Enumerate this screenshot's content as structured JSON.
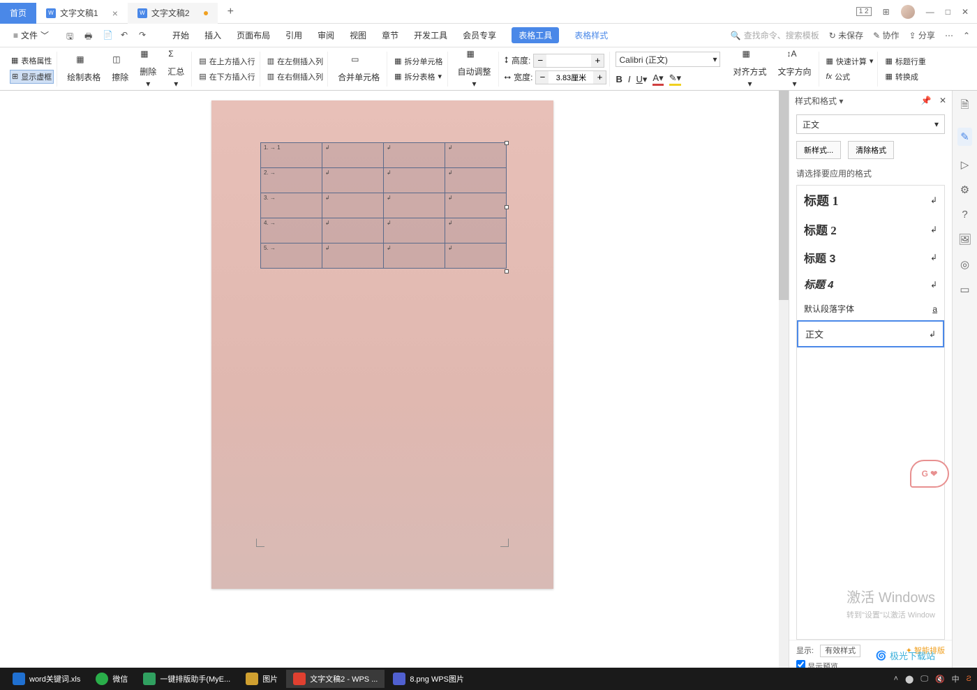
{
  "titlebar": {
    "home": "首页",
    "tabs": [
      {
        "label": "文字文稿1",
        "modified": false
      },
      {
        "label": "文字文稿2",
        "modified": true
      }
    ],
    "icon_label": "W"
  },
  "menubar": {
    "file": "文件",
    "tabs": [
      "开始",
      "插入",
      "页面布局",
      "引用",
      "审阅",
      "视图",
      "章节",
      "开发工具",
      "会员专享"
    ],
    "table_tool": "表格工具",
    "table_style": "表格样式",
    "search_placeholder": "查找命令、搜索模板",
    "right": {
      "unsaved": "未保存",
      "coop": "协作",
      "share": "分享"
    }
  },
  "ribbon": {
    "table_props": "表格属性",
    "show_frame": "显示虚框",
    "draw_table": "绘制表格",
    "eraser": "擦除",
    "delete": "删除",
    "summary": "汇总",
    "insert_above": "在上方插入行",
    "insert_below": "在下方插入行",
    "insert_left": "在左侧插入列",
    "insert_right": "在右侧插入列",
    "merge": "合并单元格",
    "split_cell": "拆分单元格",
    "split_table": "拆分表格",
    "auto_adjust": "自动调整",
    "height_label": "高度:",
    "height_value": "",
    "width_label": "宽度:",
    "width_value": "3.83厘米",
    "font_name": "Calibri (正文)",
    "align": "对齐方式",
    "text_dir": "文字方向",
    "fast_calc": "快速计算",
    "formula": "公式",
    "header_repeat": "标题行重",
    "convert": "转换成"
  },
  "doc": {
    "rows": [
      "1. → 1",
      "2. → ",
      "3. → ",
      "4. → ",
      "5. → "
    ]
  },
  "panel": {
    "title": "样式和格式",
    "current": "正文",
    "new_style": "新样式...",
    "clear": "清除格式",
    "choose_label": "请选择要应用的格式",
    "styles": [
      "标题 1",
      "标题 2",
      "标题 3",
      "标题 4",
      "默认段落字体",
      "正文"
    ],
    "show_label": "显示:",
    "show_value": "有效样式",
    "preview": "显示预览",
    "smart": "智能排版"
  },
  "watermark": {
    "line1": "激活 Windows",
    "line2": "转到\"设置\"以激活 Window"
  },
  "badge": "G ❤",
  "logo": "极光下载站",
  "taskbar": {
    "items": [
      "word关键词.xls",
      "微信",
      "一键排版助手(MyE...",
      "图片",
      "文字文稿2 - WPS ...",
      "8.png  WPS图片"
    ],
    "ime": "中"
  }
}
